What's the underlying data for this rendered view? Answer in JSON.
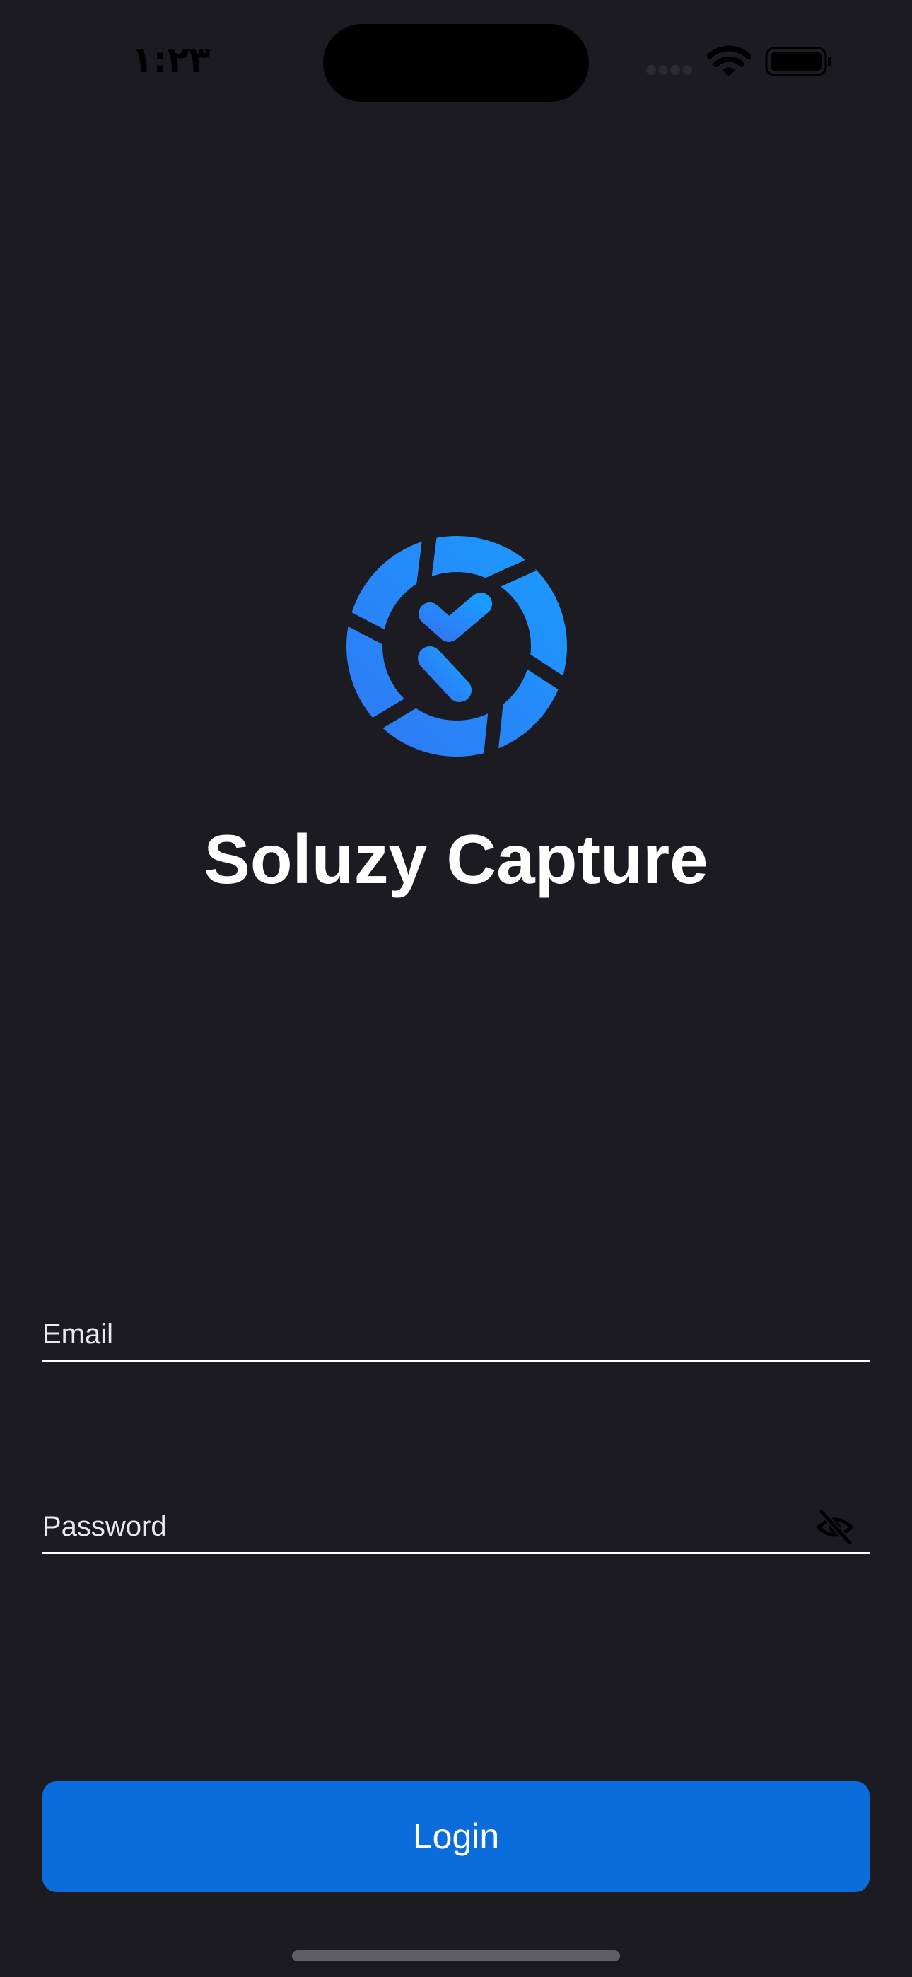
{
  "status_bar": {
    "time": "١:٢٣",
    "icons": [
      "signal-icon",
      "wifi-icon",
      "battery-icon"
    ]
  },
  "app": {
    "logo_icon": "soluzy-capture-logo",
    "title": "Soluzy Capture"
  },
  "form": {
    "email": {
      "placeholder": "Email",
      "value": ""
    },
    "password": {
      "placeholder": "Password",
      "value": "",
      "toggle_icon": "eye-slash-icon"
    },
    "login_label": "Login"
  },
  "colors": {
    "background": "#1c1b22",
    "accent": "#0b6cdc",
    "logo_gradient_start": "#3178f4",
    "logo_gradient_end": "#1a9bff",
    "text": "#ffffff"
  }
}
